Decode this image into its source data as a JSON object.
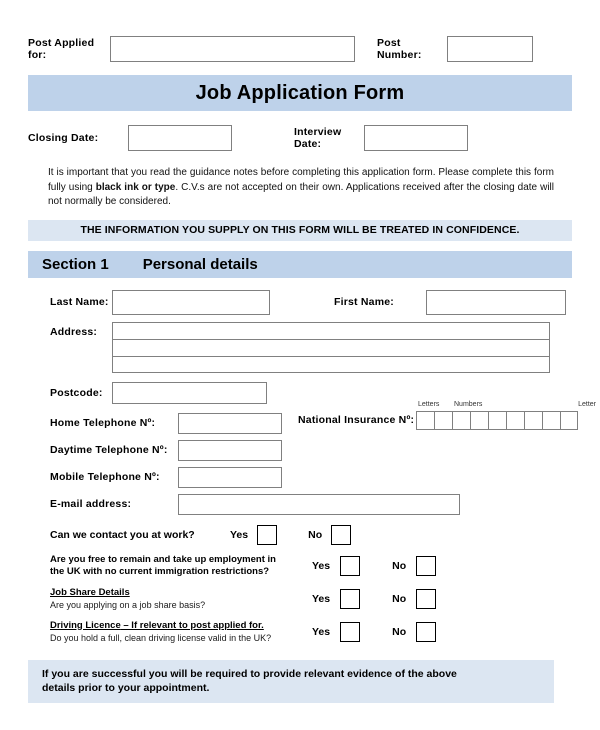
{
  "header": {
    "post_applied_label": "Post Applied for:",
    "post_applied_value": "",
    "post_number_label": "Post Number:",
    "post_number_value": "",
    "form_title": "Job Application Form",
    "closing_date_label": "Closing Date:",
    "closing_date_value": "",
    "interview_date_label": "Interview Date:",
    "interview_date_value": ""
  },
  "guidance": {
    "part1": "It is important that you read the guidance notes before completing this application form. Please complete this form fully using ",
    "emphasis": "black ink or type",
    "part2": ". C.V.s are not accepted on their own. Applications received after the closing date will not normally be considered.",
    "confidence_banner": "THE INFORMATION YOU SUPPLY ON THIS FORM WILL BE TREATED IN CONFIDENCE."
  },
  "section": {
    "number": "Section 1",
    "title": "Personal details"
  },
  "personal": {
    "last_name_label": "Last Name:",
    "last_name_value": "",
    "first_name_label": "First Name:",
    "first_name_value": "",
    "address_label": "Address:",
    "address_line1": "",
    "address_line2": "",
    "address_line3": "",
    "postcode_label": "Postcode:",
    "postcode_value": "",
    "home_phone_label": "Home Telephone Nº:",
    "home_phone_value": "",
    "daytime_phone_label": "Daytime Telephone Nº:",
    "daytime_phone_value": "",
    "mobile_phone_label": "Mobile Telephone Nº:",
    "mobile_phone_value": "",
    "email_label": "E-mail address:",
    "email_value": "",
    "ni_label": "National Insurance Nº:",
    "ni_caption_letters": "Letters",
    "ni_caption_numbers": "Numbers",
    "ni_caption_letter": "Letter",
    "ni_cell_count": 9
  },
  "questions": {
    "yes_label": "Yes",
    "no_label": "No",
    "contact_at_work": "Can we contact you at work?",
    "immigration_line1": "Are you free to remain and take up employment in",
    "immigration_line2": "the UK with no current immigration restrictions?",
    "job_share_heading": "Job Share Details",
    "job_share_sub": "Are you applying on a job share basis?",
    "driving_heading": "Driving Licence",
    "driving_heading_rest": " – If relevant to post applied for.",
    "driving_sub": "Do you hold a full, clean driving license valid in the UK?"
  },
  "footer": {
    "notice_line1": "If you are successful you will be required to provide relevant evidence of the above",
    "notice_line2": "details prior to your appointment."
  },
  "colors": {
    "banner_blue": "#bed2ea",
    "banner_pale": "#dce6f2",
    "field_border": "#808080"
  }
}
